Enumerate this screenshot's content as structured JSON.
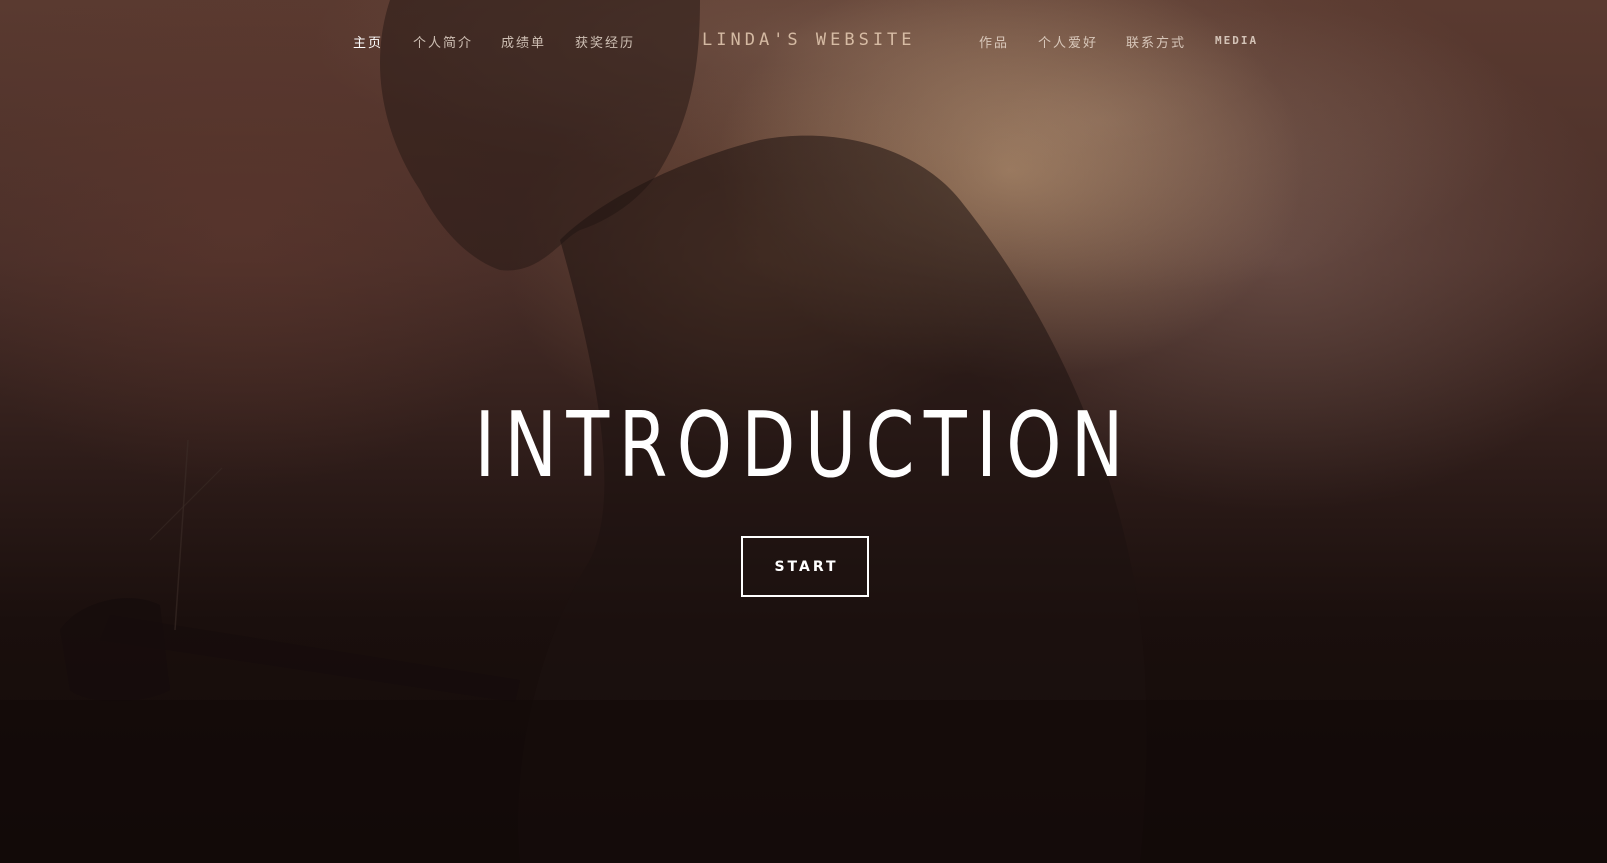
{
  "nav": {
    "left": [
      {
        "label": "主页",
        "active": true
      },
      {
        "label": "个人简介",
        "active": false
      },
      {
        "label": "成绩单",
        "active": false
      },
      {
        "label": "获奖经历",
        "active": false
      }
    ],
    "brand": "LINDA'S WEBSITE",
    "right": [
      {
        "label": "作品"
      },
      {
        "label": "个人爱好"
      },
      {
        "label": "联系方式"
      },
      {
        "label": "MEDIA"
      }
    ]
  },
  "hero": {
    "headline": "INTRODUCTION",
    "button_label": "START"
  },
  "colors": {
    "text": "#ffffff",
    "nav_text": "#ebdcd2",
    "brand_text": "#e6cdb4",
    "background_dark": "#120a09",
    "background_warm": "#5a3a30"
  }
}
